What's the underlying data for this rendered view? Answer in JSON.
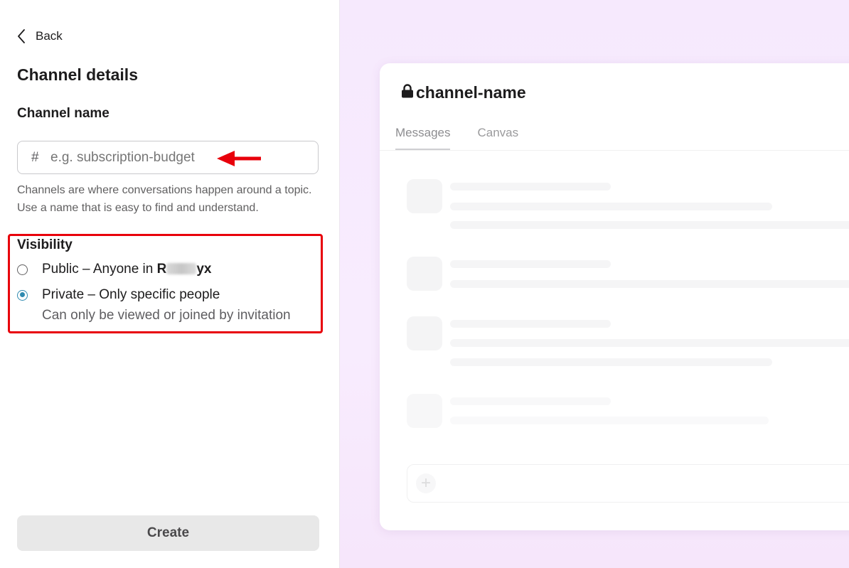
{
  "left_panel": {
    "back_label": "Back",
    "title": "Channel details",
    "channel_name_label": "Channel name",
    "channel_name_input": {
      "prefix": "#",
      "placeholder": "e.g. subscription-budget",
      "value": ""
    },
    "helper_text": "Channels are where conversations happen around a topic. Use a name that is easy to find and understand.",
    "visibility": {
      "title": "Visibility",
      "public_option": {
        "label": "Public – Anyone in ",
        "workspace_start": "R",
        "workspace_end": "yx",
        "selected": false
      },
      "private_option": {
        "label": "Private – Only specific people",
        "sublabel": "Can only be viewed or joined by invitation",
        "selected": true
      }
    },
    "create_label": "Create"
  },
  "preview": {
    "channel_title": "channel-name",
    "tabs": [
      {
        "label": "Messages",
        "active": true
      },
      {
        "label": "Canvas",
        "active": false
      }
    ],
    "composer_icon": "+"
  },
  "colors": {
    "accent_radio": "#2f8ab0",
    "annotation_red": "#e8000b",
    "preview_background": "#f6e9fd"
  },
  "icons": {
    "back": "chevron-left-icon",
    "hash": "hash-icon",
    "lock": "lock-icon",
    "plus": "plus-icon"
  }
}
